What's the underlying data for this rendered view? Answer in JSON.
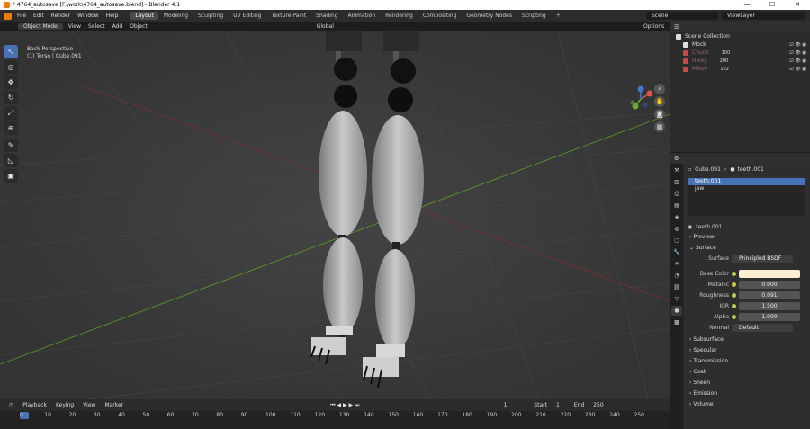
{
  "window": {
    "title": "* 4764_autosave [F:\\work\\4764_autosave.blend] - Blender 4.1",
    "min": "—",
    "max": "☐",
    "close": "✕"
  },
  "menu": [
    "File",
    "Edit",
    "Render",
    "Window",
    "Help"
  ],
  "workspaces": [
    "Layout",
    "Modeling",
    "Sculpting",
    "UV Editing",
    "Texture Paint",
    "Shading",
    "Animation",
    "Rendering",
    "Compositing",
    "Geometry Nodes",
    "Scripting",
    "+"
  ],
  "scene": {
    "label": "Scene",
    "viewlayer": "ViewLayer"
  },
  "viewport_header": {
    "mode": "Object Mode",
    "items": [
      "View",
      "Select",
      "Add",
      "Object"
    ],
    "transform": "Global",
    "options": "Options"
  },
  "viewport": {
    "perspective": "Back Perspective",
    "object": "(1) Torso | Cube.091"
  },
  "gizmo": {
    "x": "X",
    "y": "Y",
    "z": "Z"
  },
  "outliner": {
    "title": "Scene Collection",
    "search_placeholder": "",
    "items": [
      {
        "name": "Mock",
        "sub": "",
        "active": true
      },
      {
        "name": "Chuck",
        "sub": "100",
        "active": false
      },
      {
        "name": "Hikey",
        "sub": "200",
        "active": false
      },
      {
        "name": "Mikey",
        "sub": "102",
        "active": false
      }
    ]
  },
  "properties": {
    "breadcrumb_object": "Cube.091",
    "breadcrumb_material": "teeth.001",
    "slots": [
      "teeth.001",
      "jaw"
    ],
    "material_name": "teeth.001",
    "sections": {
      "preview": "Preview",
      "surface": "Surface"
    },
    "surface_label": "Surface",
    "surface_value": "Principled BSDF",
    "fields": [
      {
        "label": "Base Color",
        "value": "",
        "color": "#fbeed3"
      },
      {
        "label": "Metallic",
        "value": "0.000"
      },
      {
        "label": "Roughness",
        "value": "0.091"
      },
      {
        "label": "IOR",
        "value": "1.500"
      },
      {
        "label": "Alpha",
        "value": "1.000"
      }
    ],
    "normal_label": "Normal",
    "normal_value": "Default",
    "subsections": [
      "Subsurface",
      "Specular",
      "Transmission",
      "Coat",
      "Sheen",
      "Emission",
      "Volume"
    ]
  },
  "timeline": {
    "menu": [
      "Playback",
      "Keying",
      "View",
      "Marker"
    ],
    "current_frame": "1",
    "start_label": "Start",
    "start": "1",
    "end_label": "End",
    "end": "250",
    "ticks": [
      "0",
      "10",
      "20",
      "30",
      "40",
      "50",
      "60",
      "70",
      "80",
      "90",
      "100",
      "110",
      "120",
      "130",
      "140",
      "150",
      "160",
      "170",
      "180",
      "190",
      "200",
      "210",
      "220",
      "230",
      "240",
      "250"
    ]
  }
}
